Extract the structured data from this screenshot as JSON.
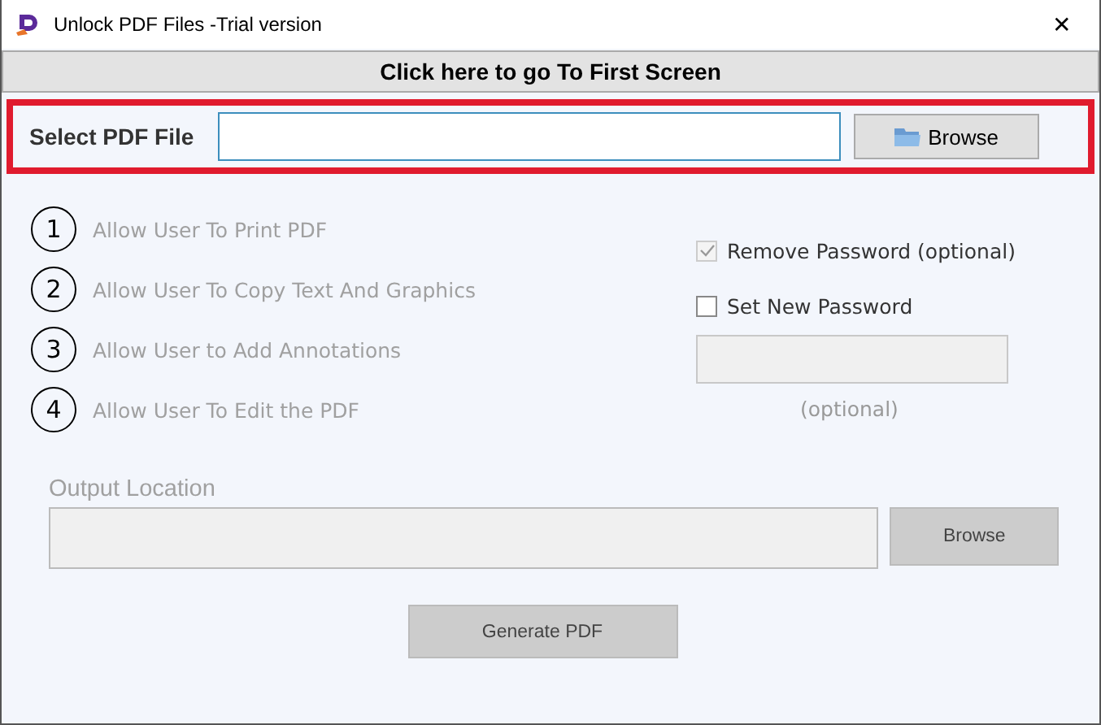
{
  "window": {
    "title": "Unlock PDF Files -Trial version",
    "close": "✕"
  },
  "first_screen_button": "Click here to go To First Screen",
  "select_file": {
    "label": "Select PDF File",
    "browse": "Browse",
    "highlighted": true
  },
  "permissions": [
    {
      "number": "1",
      "label": "Allow User To Print PDF",
      "disabled": true
    },
    {
      "number": "2",
      "label": "Allow User To Copy Text And Graphics",
      "disabled": true
    },
    {
      "number": "3",
      "label": "Allow User to Add Annotations",
      "disabled": true
    },
    {
      "number": "4",
      "label": "Allow User To Edit the PDF",
      "disabled": true
    }
  ],
  "password_options": [
    {
      "label": "Remove Password (optional)",
      "checked": true,
      "disabled": true
    },
    {
      "label": "Set New Password",
      "checked": false,
      "disabled": false
    }
  ],
  "new_password": {
    "disabled": true,
    "hint": "(optional)"
  },
  "output": {
    "label": "Output Location",
    "disabled": true,
    "browse": "Browse"
  },
  "generate_button": {
    "label": "Generate PDF",
    "disabled": true
  }
}
